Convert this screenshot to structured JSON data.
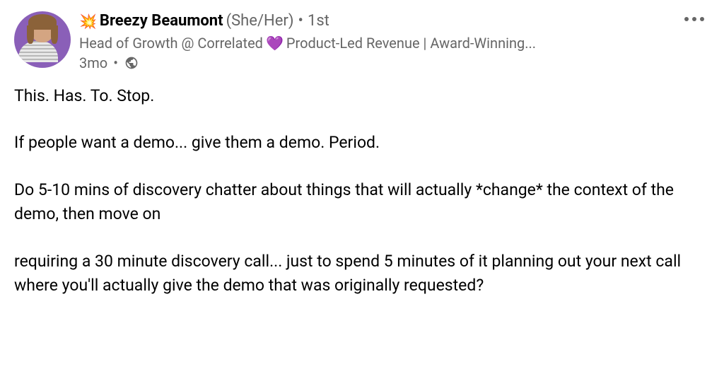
{
  "author": {
    "name_emoji": "💥",
    "name": "Breezy Beaumont",
    "pronouns": "(She/Her)",
    "connection": "1st",
    "headline_part1": "Head of Growth @ Correlated",
    "headline_heart": "💜",
    "headline_part2": "Product-Led Revenue | Award-Winning...",
    "post_age": "3mo"
  },
  "post": {
    "p1": "This. Has. To. Stop.",
    "p2": "If people want a demo... give them a demo. Period.",
    "p3": "Do 5-10 mins of discovery chatter about things that will actually *change* the context of the demo, then move on",
    "p4": "requiring a 30 minute discovery call... just to spend 5 minutes of it planning out your next call where you'll actually give the demo that was originally requested?"
  },
  "separators": {
    "dot": "•"
  }
}
